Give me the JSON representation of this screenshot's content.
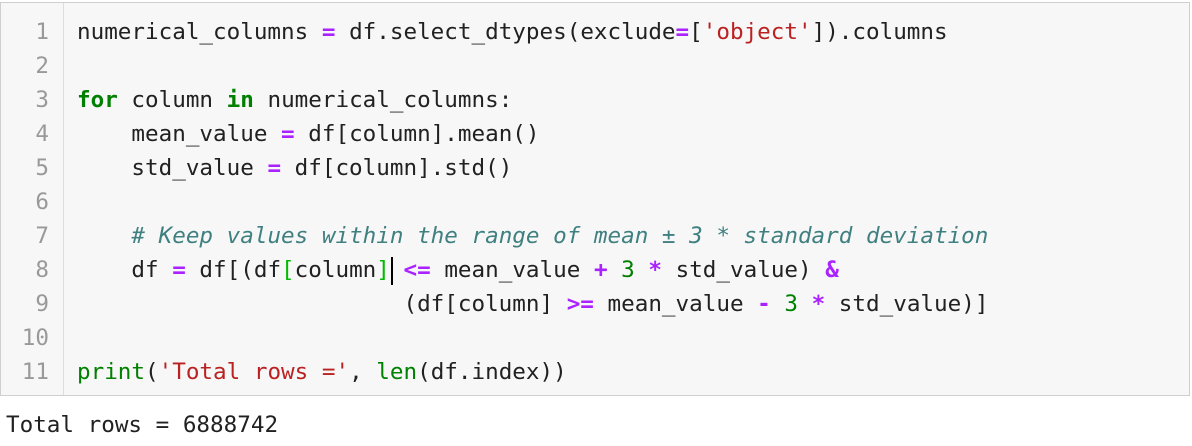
{
  "editor": {
    "line_numbers": [
      "1",
      "2",
      "3",
      "4",
      "5",
      "6",
      "7",
      "8",
      "9",
      "10",
      "11"
    ],
    "line1": {
      "var": "numerical_columns ",
      "eq": "=",
      "mid": " df.select_dtypes(exclude",
      "eq2": "=",
      "open": "[",
      "str": "'object'",
      "close": "]).columns"
    },
    "line3": {
      "for": "for",
      "var": " column ",
      "in": "in",
      "rest": " numerical_columns:"
    },
    "line4": {
      "pre": "    mean_value ",
      "eq": "=",
      "rest": " df[column].mean()"
    },
    "line5": {
      "pre": "    std_value ",
      "eq": "=",
      "rest": " df[column].std()"
    },
    "line7": {
      "indent": "    ",
      "comment": "# Keep values within the range of mean ± 3 * standard deviation"
    },
    "line8": {
      "pre": "    df ",
      "eq": "=",
      "a": " df[(df",
      "b1": "[",
      "b": "column",
      "b2": "]",
      "c": " ",
      "le": "<=",
      "d": " mean_value ",
      "plus": "+",
      "e": " ",
      "three": "3",
      "f": " ",
      "mul": "*",
      "g": " std_value) ",
      "amp": "&"
    },
    "line9": {
      "pre": "                        (df[column] ",
      "ge": ">=",
      "a": " mean_value ",
      "minus": "-",
      "b": " ",
      "three": "3",
      "c": " ",
      "mul": "*",
      "d": " std_value)]"
    },
    "line11": {
      "print": "print",
      "open": "(",
      "str": "'Total rows ='",
      "mid": ", ",
      "len": "len",
      "rest": "(df.index))"
    }
  },
  "output": {
    "text": "Total rows = 6888742"
  },
  "colors": {
    "keyword": "#008000",
    "operator": "#aa22ff",
    "string": "#ba2121",
    "comment": "#408080",
    "bracket_match": "#00bb00",
    "cell_background": "#f7f7f7"
  }
}
